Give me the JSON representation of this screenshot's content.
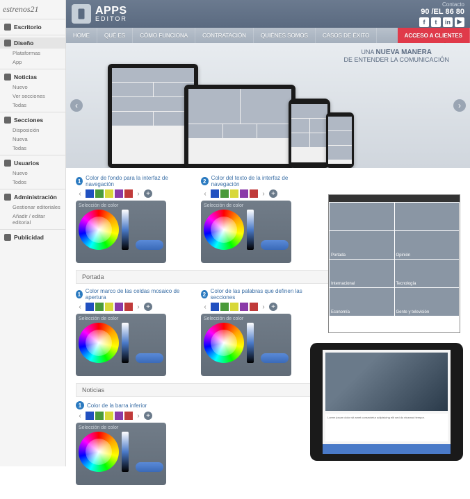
{
  "brand": "estrenos21",
  "sidebar": {
    "groups": [
      {
        "icon": "home",
        "title": "Escritorio",
        "items": []
      },
      {
        "icon": "pencil",
        "title": "Diseño",
        "active": true,
        "items": [
          "Plataformas",
          "App"
        ]
      },
      {
        "icon": "bell",
        "title": "Noticias",
        "items": [
          "Nuevo",
          "Ver secciones",
          "Todas"
        ]
      },
      {
        "icon": "grid",
        "title": "Secciones",
        "items": [
          "Disposición",
          "Nueva",
          "Todas"
        ]
      },
      {
        "icon": "user",
        "title": "Usuarios",
        "items": [
          "Nuevo",
          "Todos"
        ]
      },
      {
        "icon": "gear",
        "title": "Administración",
        "items": [
          "Gestionar editoriales",
          "Añadir / editar editorial"
        ]
      },
      {
        "icon": "megaphone",
        "title": "Publicidad",
        "items": []
      }
    ]
  },
  "header": {
    "app_name": "APPS",
    "app_sub": "EDITOR",
    "contact_label": "Contacto",
    "phone": "90 /EL 86 80",
    "social": [
      "f",
      "t",
      "in",
      "▶"
    ]
  },
  "nav": {
    "items": [
      "HOME",
      "QUÉ ES",
      "CÓMO FUNCIONA",
      "CONTRATACIÓN",
      "QUIÉNES SOMOS",
      "CASOS DE ÉXITO"
    ],
    "access": "ACCESO A CLIENTES"
  },
  "hero": {
    "line1": "UNA ",
    "line1b": "NUEVA MANERA",
    "line2": "DE ENTENDER LA COMUNICACIÓN"
  },
  "editor": {
    "opt1": "Color de fondo para la interfaz de navegación",
    "opt2": "Color del texto de la interfaz de navegación",
    "section_portada": "Portada",
    "opt3": "Color marco de las celdas mosaico de apertura",
    "opt4": "Color de las palabras que definen las secciones",
    "section_noticias": "Noticias",
    "opt5": "Color de la barra inferior",
    "picker_title": "Selección de color",
    "swatches": [
      "bl",
      "gr",
      "yl",
      "pu",
      "rd"
    ]
  },
  "phone_preview": {
    "cells": [
      "",
      "",
      "Portada",
      "Opinión",
      "Internacional",
      "Tecnología",
      "Economía",
      "Gente y televisión"
    ]
  }
}
